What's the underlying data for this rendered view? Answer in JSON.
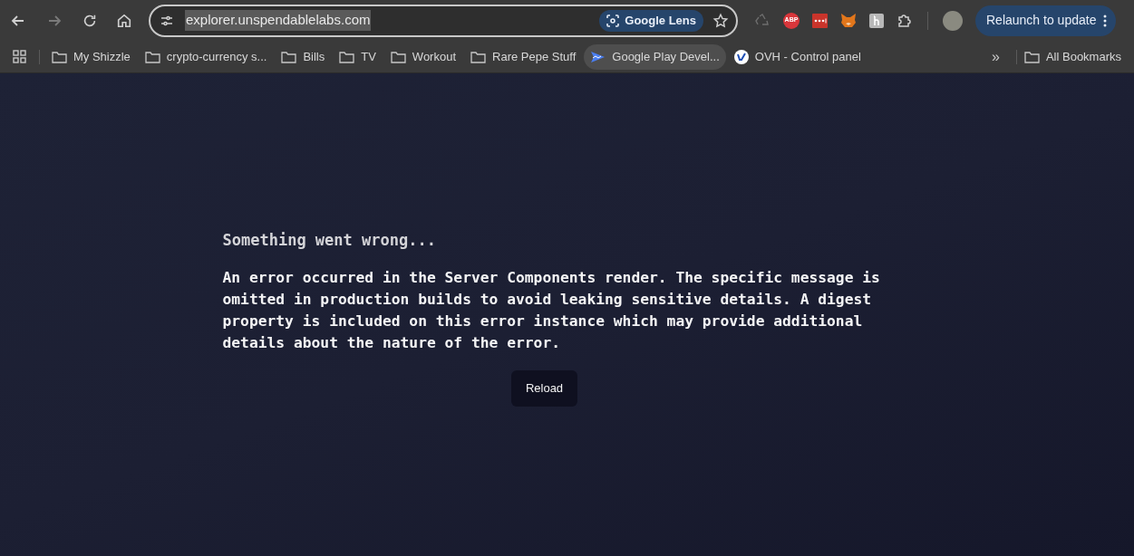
{
  "toolbar": {
    "url": "explorer.unspendablelabs.com",
    "lens_label": "Google Lens",
    "relaunch_label": "Relaunch to update",
    "extensions": [
      {
        "kind": "recycle"
      },
      {
        "kind": "abp",
        "label": "ABP"
      },
      {
        "kind": "dots"
      },
      {
        "kind": "fox"
      },
      {
        "kind": "letter"
      },
      {
        "kind": "puzzle"
      }
    ]
  },
  "bookmarks": {
    "items": [
      {
        "kind": "folder",
        "label": "My Shizzle",
        "hovered": false
      },
      {
        "kind": "folder",
        "label": "crypto-currency s...",
        "hovered": false
      },
      {
        "kind": "folder",
        "label": "Bills",
        "hovered": false
      },
      {
        "kind": "folder",
        "label": "TV",
        "hovered": false
      },
      {
        "kind": "folder",
        "label": "Workout",
        "hovered": false
      },
      {
        "kind": "folder",
        "label": "Rare Pepe Stuff",
        "hovered": false
      },
      {
        "kind": "play",
        "label": "Google Play Devel...",
        "hovered": true
      },
      {
        "kind": "ovh",
        "label": "OVH - Control panel",
        "hovered": false
      }
    ],
    "overflow": "»",
    "all_label": "All Bookmarks"
  },
  "error": {
    "title": "Something went wrong...",
    "message": "An error occurred in the Server Components render. The specific message is omitted in production builds to avoid leaking sensitive details. A digest property is included on this error instance which may provide additional details about the nature of the error.",
    "button": "Reload"
  }
}
